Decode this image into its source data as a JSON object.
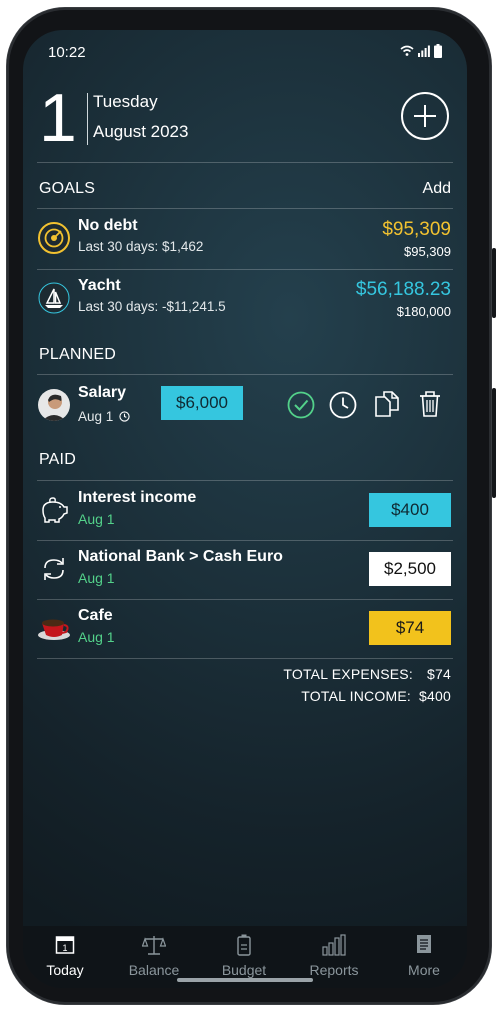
{
  "status_bar": {
    "time": "10:22"
  },
  "header": {
    "day": "1",
    "weekday": "Tuesday",
    "month_year": "August 2023"
  },
  "goals": {
    "title": "GOALS",
    "action": "Add",
    "items": [
      {
        "name": "No debt",
        "subtitle": "Last 30 days: $1,462",
        "amount": "$95,309",
        "target": "$95,309",
        "amount_color": "#f2c230",
        "icon": "target-icon"
      },
      {
        "name": "Yacht",
        "subtitle": "Last 30 days: -$11,241.5",
        "amount": "$56,188.23",
        "target": "$180,000",
        "amount_color": "#35c6df",
        "icon": "sailboat-icon"
      }
    ]
  },
  "planned": {
    "title": "PLANNED",
    "items": [
      {
        "name": "Salary",
        "date": "Aug 1",
        "amount": "$6,000",
        "amount_color": "#35c6df"
      }
    ]
  },
  "paid": {
    "title": "PAID",
    "items": [
      {
        "name": "Interest income",
        "date": "Aug 1",
        "amount": "$400",
        "pill_bg": "#35c6df",
        "pill_fg": "#0f2a33",
        "icon": "piggy-bank-icon"
      },
      {
        "name": "National Bank > Cash Euro",
        "date": "Aug 1",
        "amount": "$2,500",
        "pill_bg": "#ffffff",
        "pill_fg": "#111111",
        "icon": "transfer-icon"
      },
      {
        "name": "Cafe",
        "date": "Aug 1",
        "amount": "$74",
        "pill_bg": "#f2c21c",
        "pill_fg": "#1a1a1a",
        "icon": "coffee-cup-icon"
      }
    ]
  },
  "totals": {
    "expenses_label": "TOTAL EXPENSES:",
    "expenses": "$74",
    "income_label": "TOTAL INCOME:",
    "income": "$400"
  },
  "tabs": [
    {
      "label": "Today",
      "icon": "calendar-icon",
      "active": true
    },
    {
      "label": "Balance",
      "icon": "scales-icon",
      "active": false
    },
    {
      "label": "Budget",
      "icon": "battery-icon",
      "active": false
    },
    {
      "label": "Reports",
      "icon": "bar-chart-icon",
      "active": false
    },
    {
      "label": "More",
      "icon": "document-icon",
      "active": false
    }
  ]
}
